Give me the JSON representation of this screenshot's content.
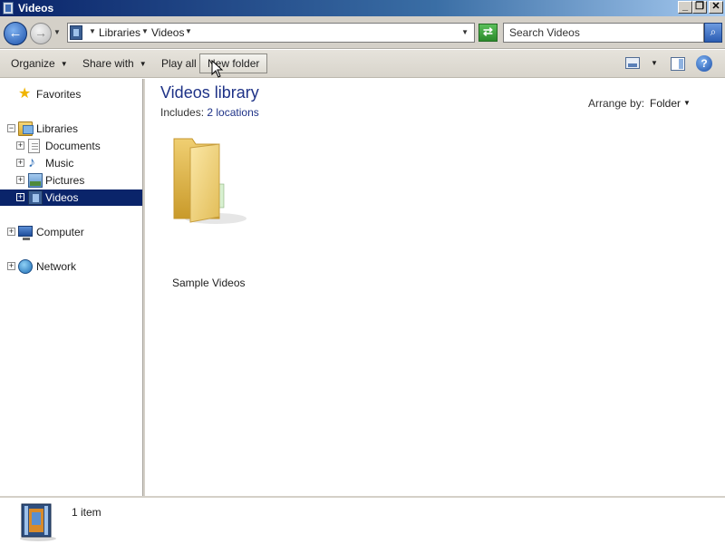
{
  "window": {
    "title": "Videos"
  },
  "title_controls": {
    "minimize": "_",
    "maximize": "❐",
    "close": "✕"
  },
  "address_bar": {
    "crumbs": [
      "Libraries",
      "Videos"
    ],
    "refresh_glyph": "⇄"
  },
  "search": {
    "placeholder": "Search Videos"
  },
  "toolbar": {
    "organize": "Organize",
    "share_with": "Share with",
    "play_all": "Play all",
    "new_folder": "New folder"
  },
  "nav": {
    "favorites": "Favorites",
    "libraries": "Libraries",
    "documents": "Documents",
    "music": "Music",
    "pictures": "Pictures",
    "videos": "Videos",
    "computer": "Computer",
    "network": "Network"
  },
  "content": {
    "title": "Videos library",
    "includes_label": "Includes:",
    "includes_value": "2 locations",
    "arrange_label": "Arrange by:",
    "arrange_value": "Folder",
    "items": [
      {
        "name": "Sample Videos"
      }
    ]
  },
  "details": {
    "count": "1 item"
  },
  "colors": {
    "selection": "#0a246a",
    "accent_link": "#1e3287"
  }
}
